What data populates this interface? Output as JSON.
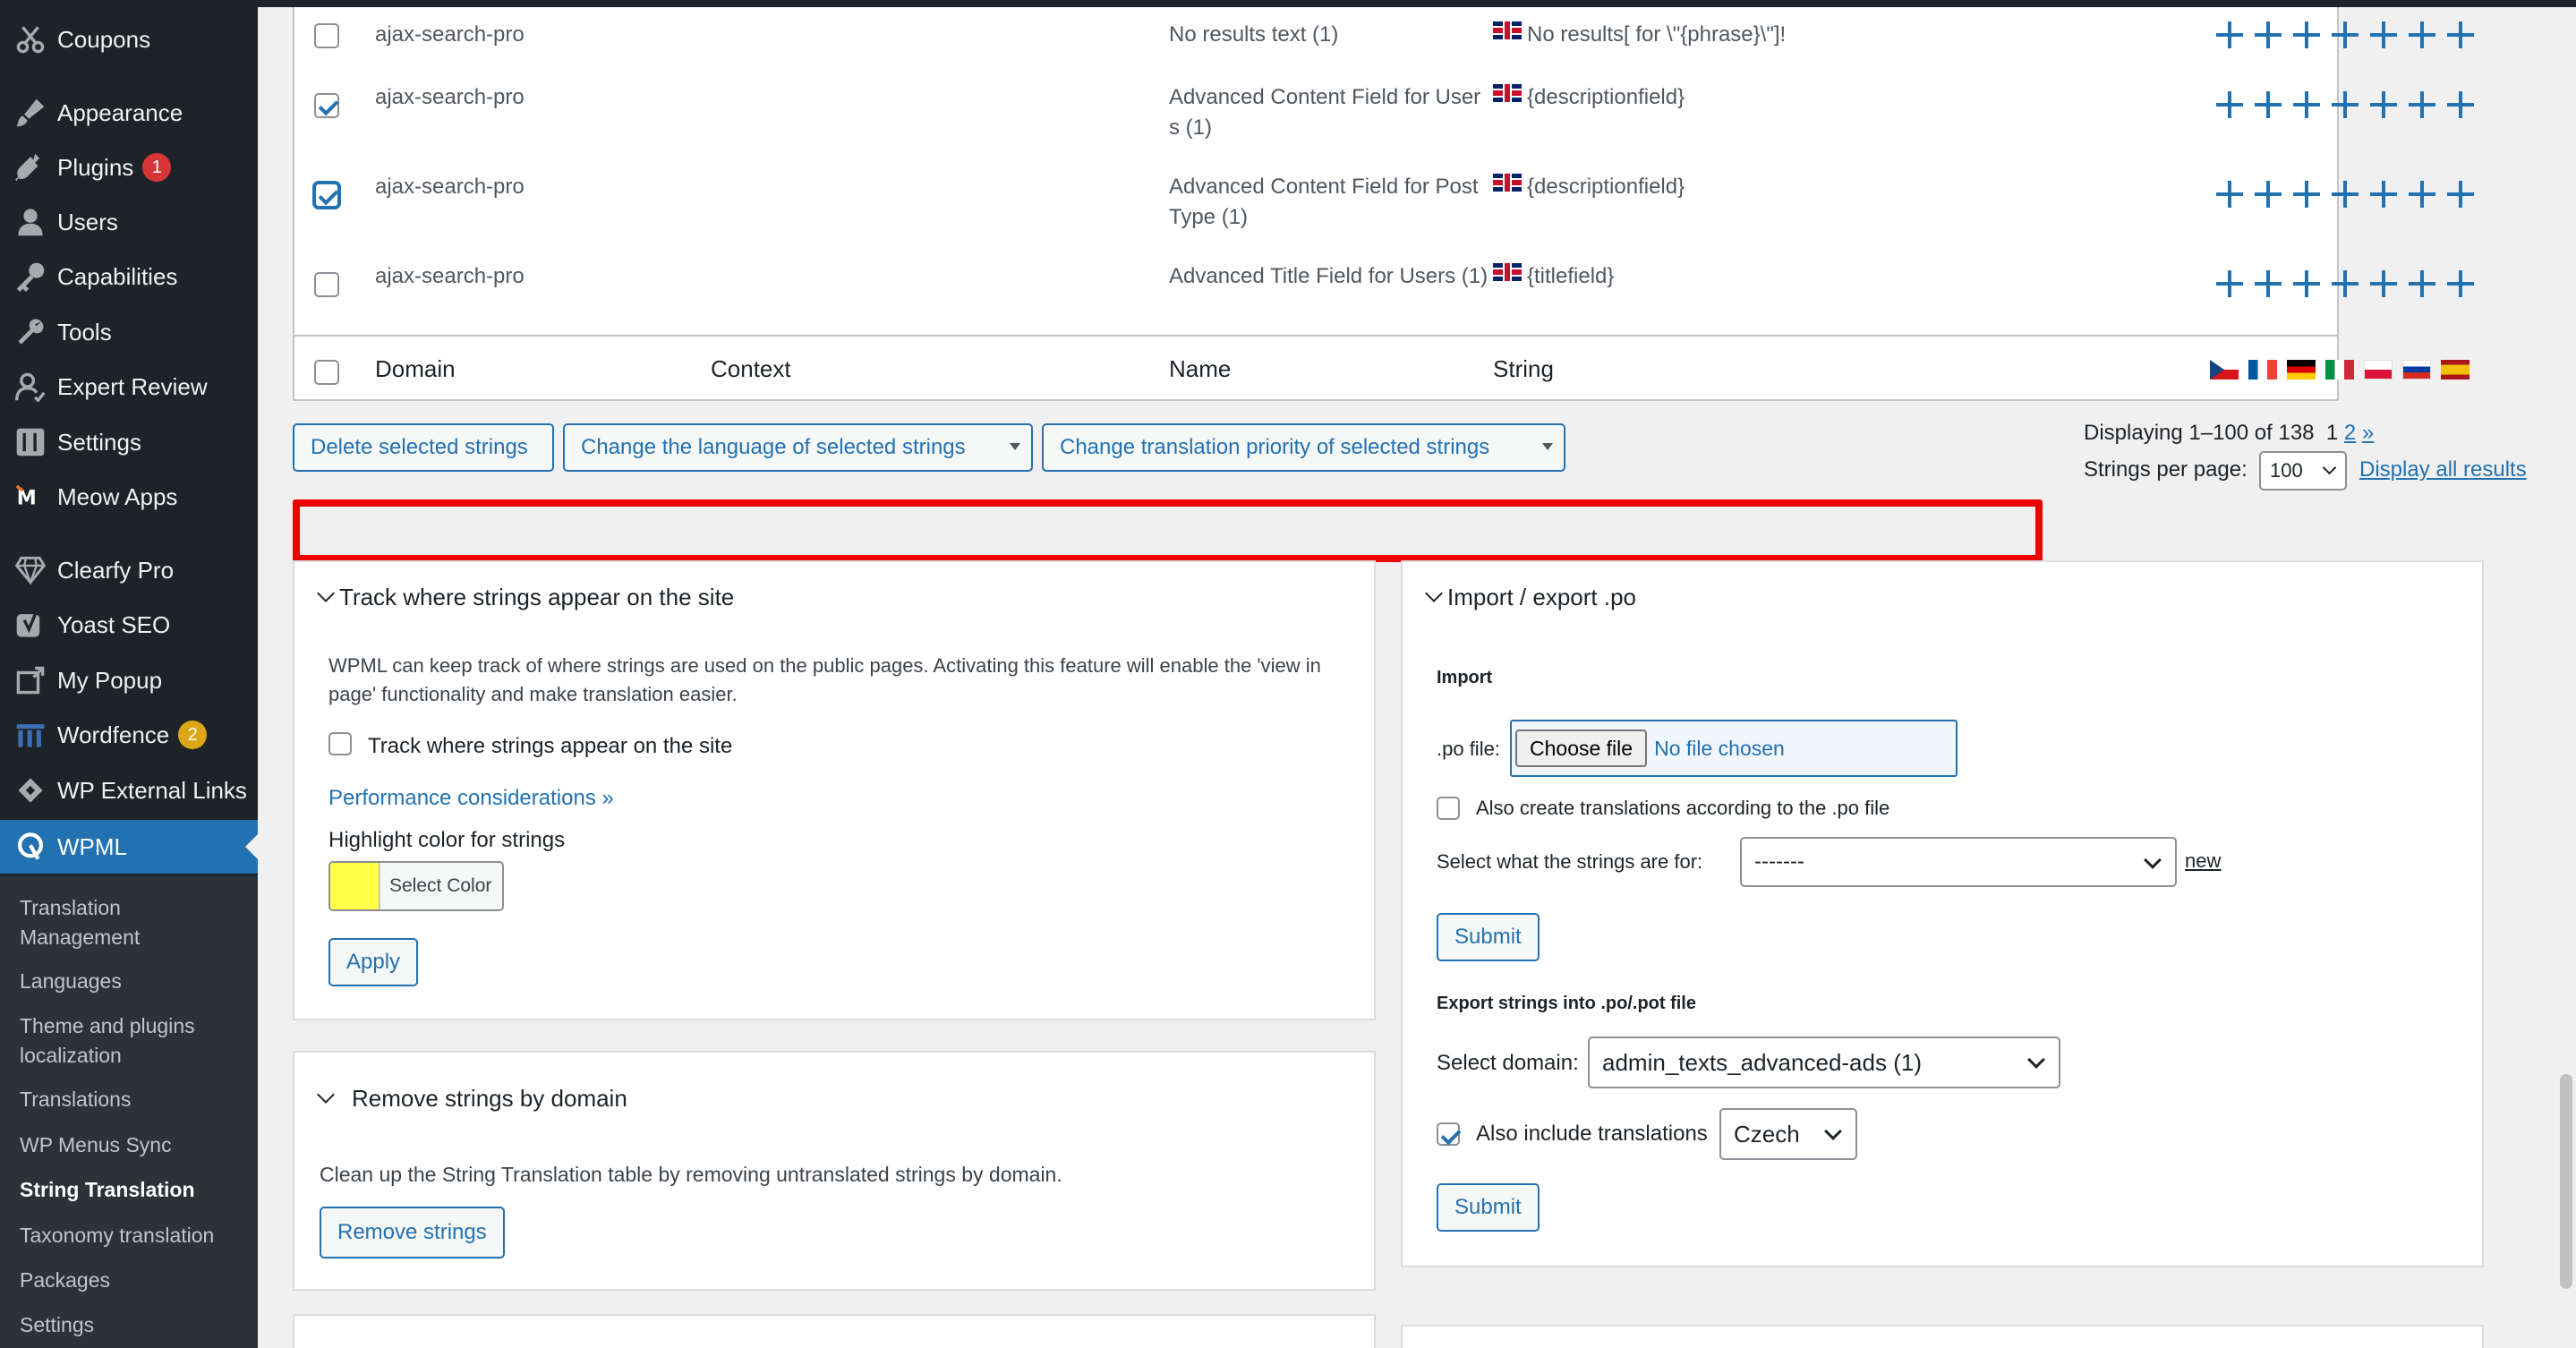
{
  "sidebar": {
    "items": [
      {
        "label": "Coupons",
        "icon": "scissors-icon"
      },
      {
        "label": "Appearance",
        "icon": "paintbrush-icon"
      },
      {
        "label": "Plugins",
        "icon": "plugin-icon",
        "badge": "1"
      },
      {
        "label": "Users",
        "icon": "user-icon"
      },
      {
        "label": "Capabilities",
        "icon": "key-icon"
      },
      {
        "label": "Tools",
        "icon": "wrench-icon"
      },
      {
        "label": "Expert Review",
        "icon": "expert-icon"
      },
      {
        "label": "Settings",
        "icon": "settings-icon"
      },
      {
        "label": "Meow Apps",
        "icon": "meow-icon"
      },
      {
        "label": "Clearfy Pro",
        "icon": "diamond-icon"
      },
      {
        "label": "Yoast SEO",
        "icon": "yoast-icon"
      },
      {
        "label": "My Popup",
        "icon": "popup-icon"
      },
      {
        "label": "Wordfence",
        "icon": "wordfence-icon",
        "badge": "2"
      },
      {
        "label": "WP External Links",
        "icon": "link-icon"
      },
      {
        "label": "WPML",
        "icon": "wpml-icon"
      }
    ],
    "submenu": [
      "Translation Management",
      "Languages",
      "Theme and plugins localization",
      "Translations",
      "WP Menus Sync",
      "String Translation",
      "Taxonomy translation",
      "Packages",
      "Settings"
    ]
  },
  "table": {
    "rows": [
      {
        "checked": false,
        "domain": "ajax-search-pro",
        "name": "No results text (1)",
        "string": "No results[ for \\\"{phrase}\\\"]!"
      },
      {
        "checked": true,
        "domain": "ajax-search-pro",
        "name": "Advanced Content Field for Users (1)",
        "string": "{descriptionfield}"
      },
      {
        "checked": true,
        "domain": "ajax-search-pro",
        "name": "Advanced Content Field for Post Type (1)",
        "string": "{descriptionfield}"
      },
      {
        "checked": false,
        "domain": "ajax-search-pro",
        "name": "Advanced Title Field for Users (1)",
        "string": "{titlefield}"
      }
    ],
    "footer": {
      "domain": "Domain",
      "context": "Context",
      "name": "Name",
      "string": "String"
    },
    "footer_flags": [
      "Czech",
      "French",
      "German",
      "Italian",
      "Polish",
      "Russian",
      "Spanish"
    ]
  },
  "bulk": {
    "delete": "Delete selected strings",
    "change_language": "Change the language of selected strings",
    "change_priority": "Change translation priority of selected strings"
  },
  "pager": {
    "displaying": "Displaying 1–100 of 138",
    "page_current": "1",
    "page_next": "2",
    "page_next_arrow": "»",
    "per_page_label": "Strings per page:",
    "per_page_value": "100",
    "display_all": "Display all results"
  },
  "track": {
    "title": "Track where strings appear on the site",
    "description": "WPML can keep track of where strings are used on the public pages. Activating this feature will enable the 'view in page' functionality and make translation easier.",
    "checkbox_label": "Track where strings appear on the site",
    "perf_link": "Performance considerations »",
    "highlight_label": "Highlight color for strings",
    "highlight_color": "#ffff47",
    "select_color": "Select Color",
    "apply": "Apply"
  },
  "remove": {
    "title": "Remove strings by domain",
    "description": "Clean up the String Translation table by removing untranslated strings by domain.",
    "button": "Remove strings"
  },
  "import_export": {
    "title": "Import / export .po",
    "import_heading": "Import",
    "po_file_label": ".po file:",
    "choose_file": "Choose file",
    "no_file": "No file chosen",
    "also_create": "Also create translations according to the .po file",
    "select_for_label": "Select what the strings are for:",
    "select_for_value": "-------",
    "new_link": "new",
    "submit": "Submit",
    "export_heading": "Export strings into .po/.pot file",
    "select_domain_label": "Select domain:",
    "select_domain_value": "admin_texts_advanced-ads (1)",
    "include_translations_label": "Also include translations",
    "include_translations_checked": true,
    "language_value": "Czech",
    "submit2": "Submit"
  }
}
